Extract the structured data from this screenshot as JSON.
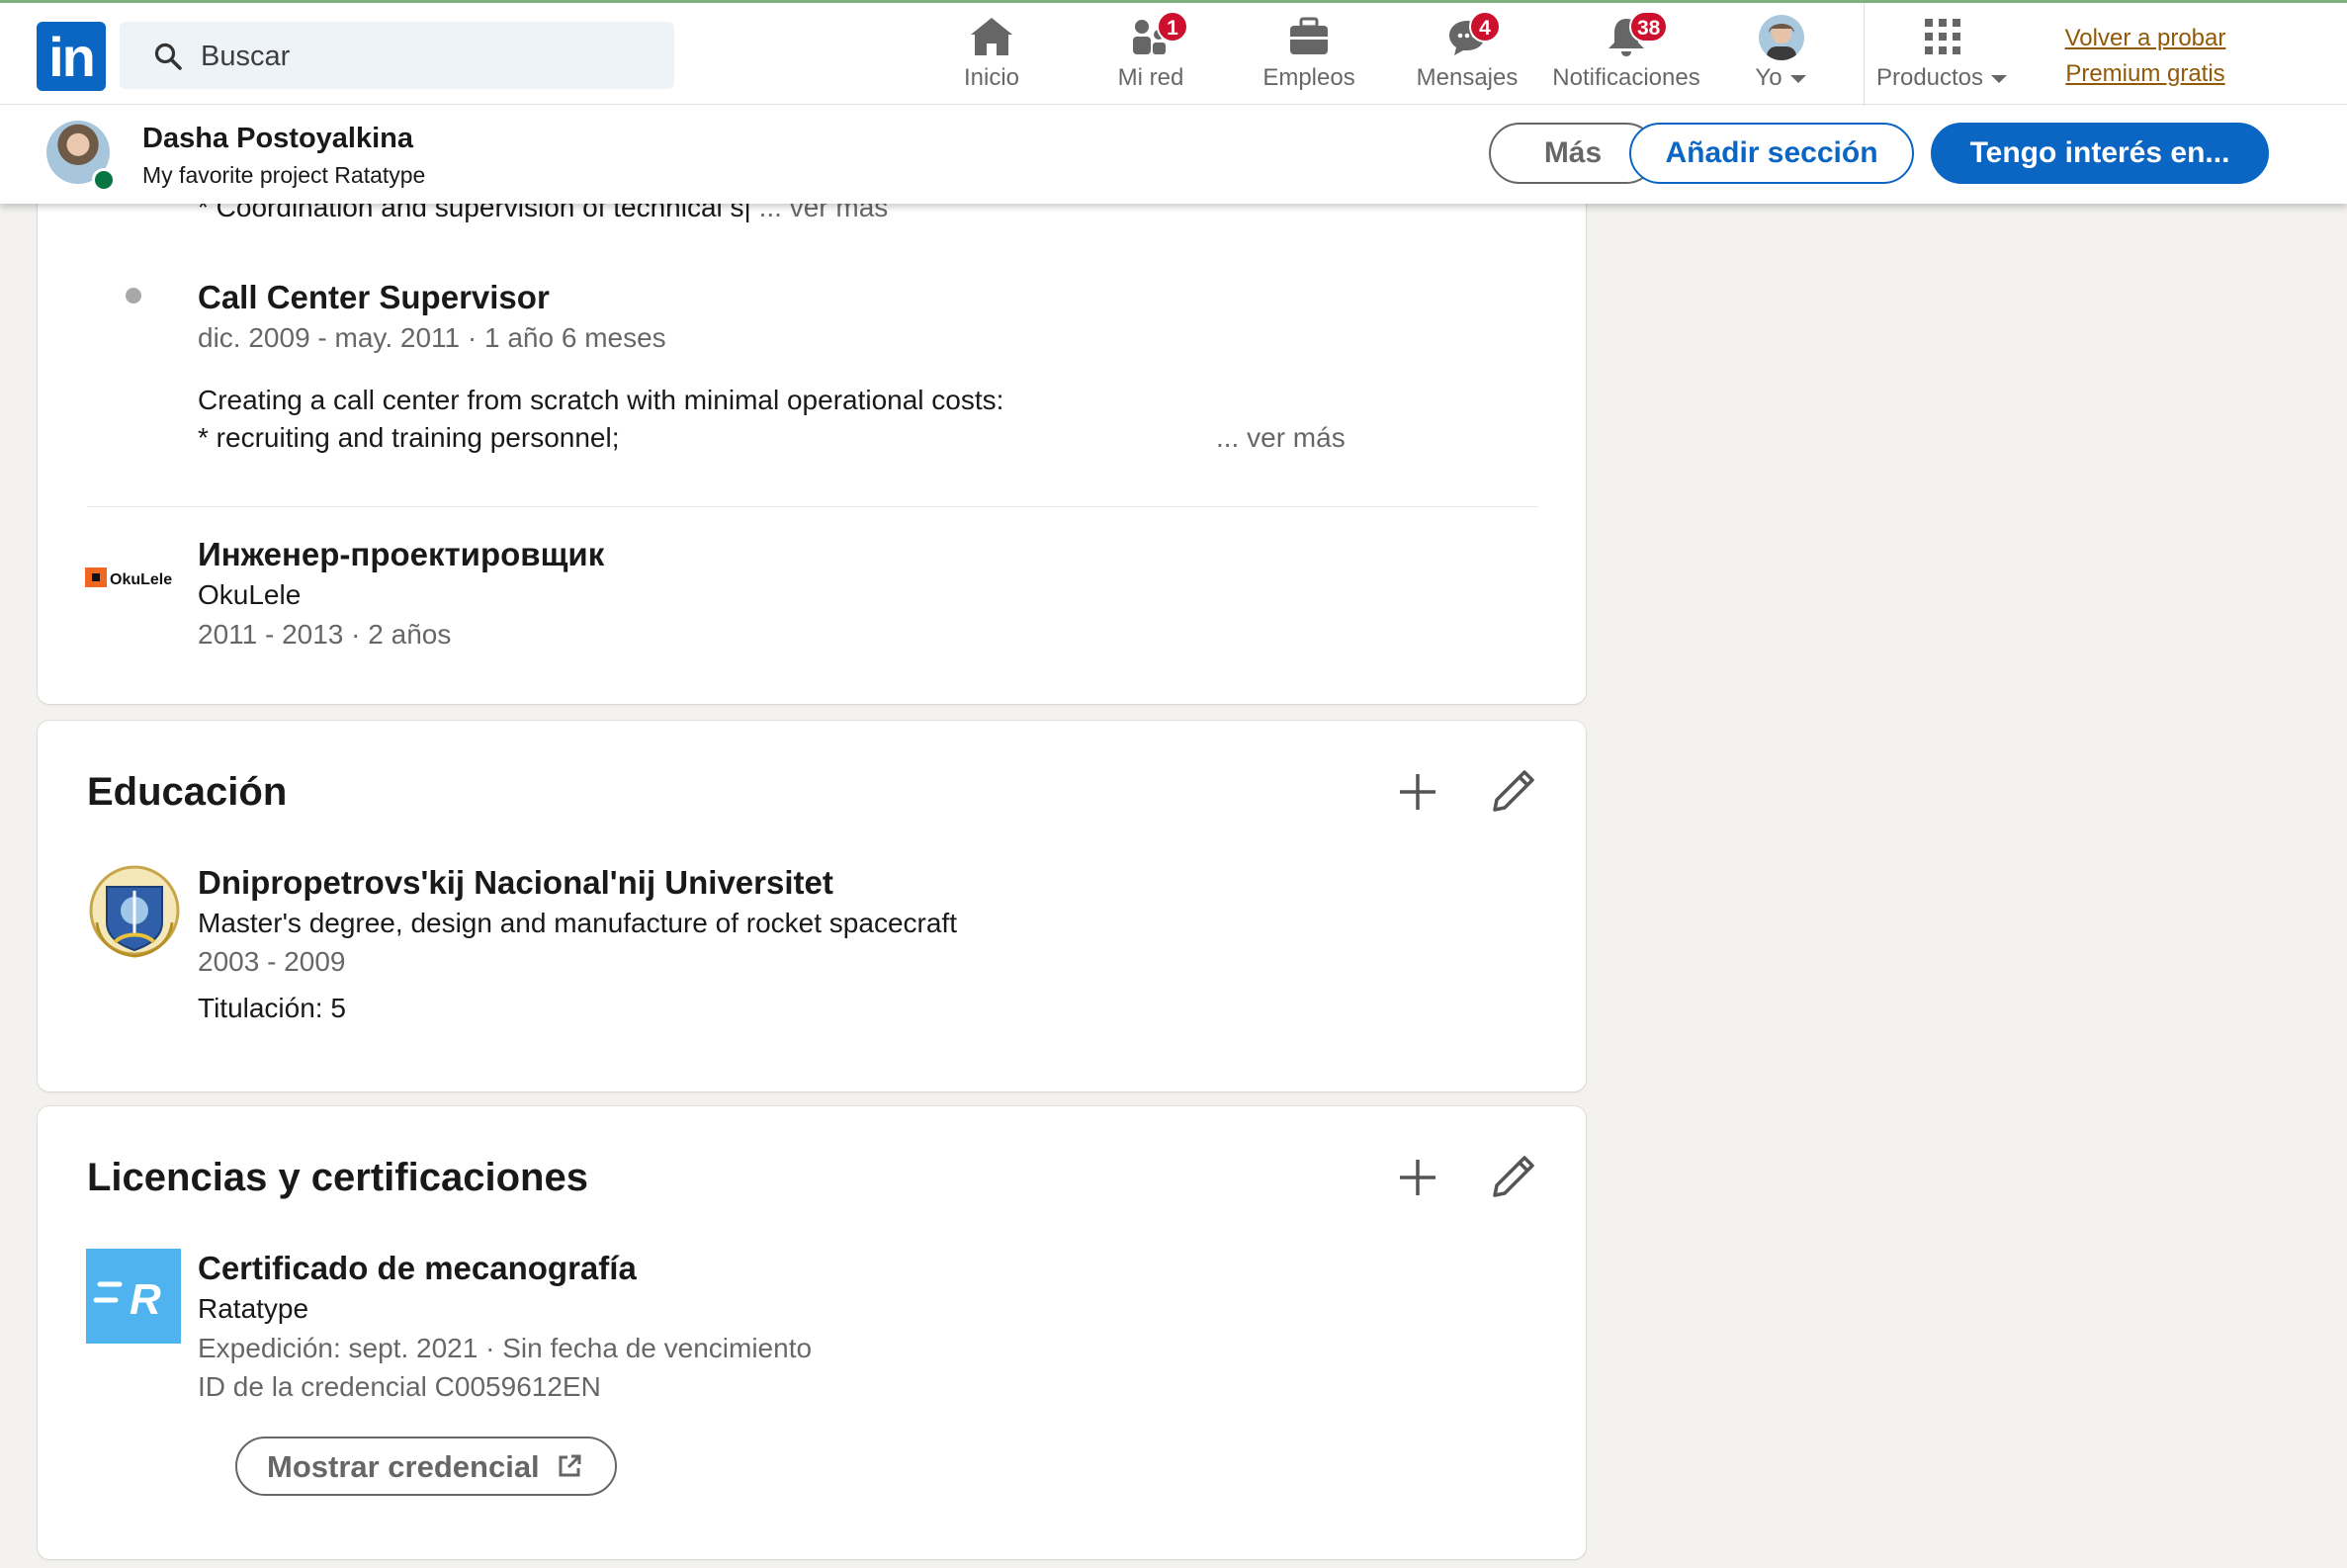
{
  "nav": {
    "logo_text": "in",
    "search_placeholder": "Buscar",
    "items": [
      {
        "label": "Inicio",
        "icon": "home-icon"
      },
      {
        "label": "Mi red",
        "icon": "network-icon",
        "badge": "1"
      },
      {
        "label": "Empleos",
        "icon": "briefcase-icon"
      },
      {
        "label": "Mensajes",
        "icon": "messaging-icon",
        "badge": "4"
      },
      {
        "label": "Notificaciones",
        "icon": "bell-icon",
        "badge": "38"
      },
      {
        "label": "Yo",
        "icon": "avatar"
      },
      {
        "label": "Productos",
        "icon": "grid-icon"
      }
    ],
    "premium_line1": "Volver a probar",
    "premium_line2": "Premium gratis"
  },
  "profile_bar": {
    "name": "Dasha Postoyalkina",
    "headline": "My favorite project Ratatype",
    "more_label": "Más",
    "add_section_label": "Añadir sección",
    "open_to_label": "Tengo interés en..."
  },
  "experience": {
    "truncated_line": "* Coordination and supervision of technical s|",
    "truncated_more": "... ver más",
    "roles": [
      {
        "title": "Call Center Supervisor",
        "dates": "dic. 2009 - may. 2011 · 1 año 6 meses",
        "desc_line1": "Creating a call center from scratch with minimal operational costs:",
        "desc_line2": "* recruiting and training personnel;",
        "more": "... ver más"
      }
    ],
    "positions": [
      {
        "title": "Инженер-проектировщик",
        "company": "OkuLele",
        "dates": "2011 - 2013 · 2 años",
        "logo_text": "OkuLele"
      }
    ]
  },
  "education": {
    "title": "Educación",
    "entries": [
      {
        "school": "Dnipropetrovs'kij Nacional'nij Universitet",
        "degree": "Master's degree, design and manufacture of rocket spacecraft",
        "dates": "2003 - 2009",
        "grade": "Titulación: 5"
      }
    ]
  },
  "licenses": {
    "title": "Licencias y certificaciones",
    "entries": [
      {
        "name": "Certificado de mecanografía",
        "issuer": "Ratatype",
        "issued": "Expedición: sept. 2021 · Sin fecha de vencimiento",
        "credential_id": "ID de la credencial C0059612EN",
        "button": "Mostrar credencial",
        "logo_letter": "R"
      }
    ]
  },
  "colors": {
    "brand_blue": "#0a66c2",
    "badge_red": "#cb112d",
    "premium_gold": "#915907",
    "ratatype_blue": "#4fb3f0",
    "okulele_orange": "#f26522"
  }
}
